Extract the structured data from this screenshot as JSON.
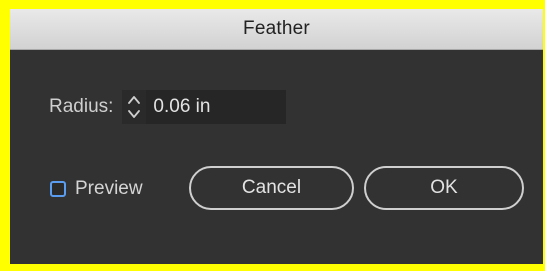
{
  "dialog": {
    "title": "Feather",
    "radius": {
      "label": "Radius:",
      "value": "0.06 in"
    },
    "preview": {
      "label": "Preview",
      "checked": false
    },
    "buttons": {
      "cancel": "Cancel",
      "ok": "OK"
    }
  },
  "colors": {
    "background_highlight": "#ffff00",
    "dialog_body": "#323232",
    "checkbox_accent": "#5a9cf0"
  }
}
